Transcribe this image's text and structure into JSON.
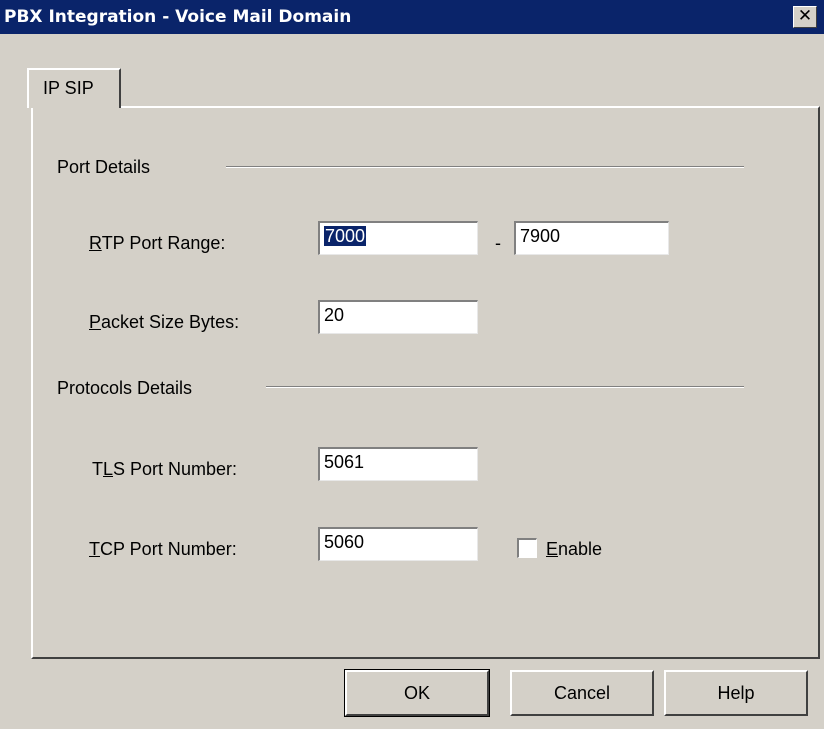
{
  "window": {
    "title": "PBX Integration - Voice Mail Domain",
    "close_glyph": "✕"
  },
  "tab": {
    "label": "IP SIP"
  },
  "port_details": {
    "heading": "Port Details",
    "rtp": {
      "label_mnemonic": "R",
      "label_rest": "TP Port Range:",
      "start": "7000",
      "separator": "-",
      "end": "7900"
    },
    "packet": {
      "label_mnemonic": "P",
      "label_rest": "acket Size Bytes:",
      "value": "20"
    }
  },
  "protocols_details": {
    "heading": "Protocols Details",
    "tls": {
      "label_pre": "T",
      "label_mnemonic": "L",
      "label_rest": "S Port Number:",
      "value": "5061"
    },
    "tcp": {
      "label_mnemonic": "T",
      "label_rest": "CP Port Number:",
      "value": "5060"
    },
    "enable": {
      "label_mnemonic": "E",
      "label_rest": "nable",
      "checked": false
    }
  },
  "buttons": {
    "ok": "OK",
    "cancel": "Cancel",
    "help": "Help"
  }
}
